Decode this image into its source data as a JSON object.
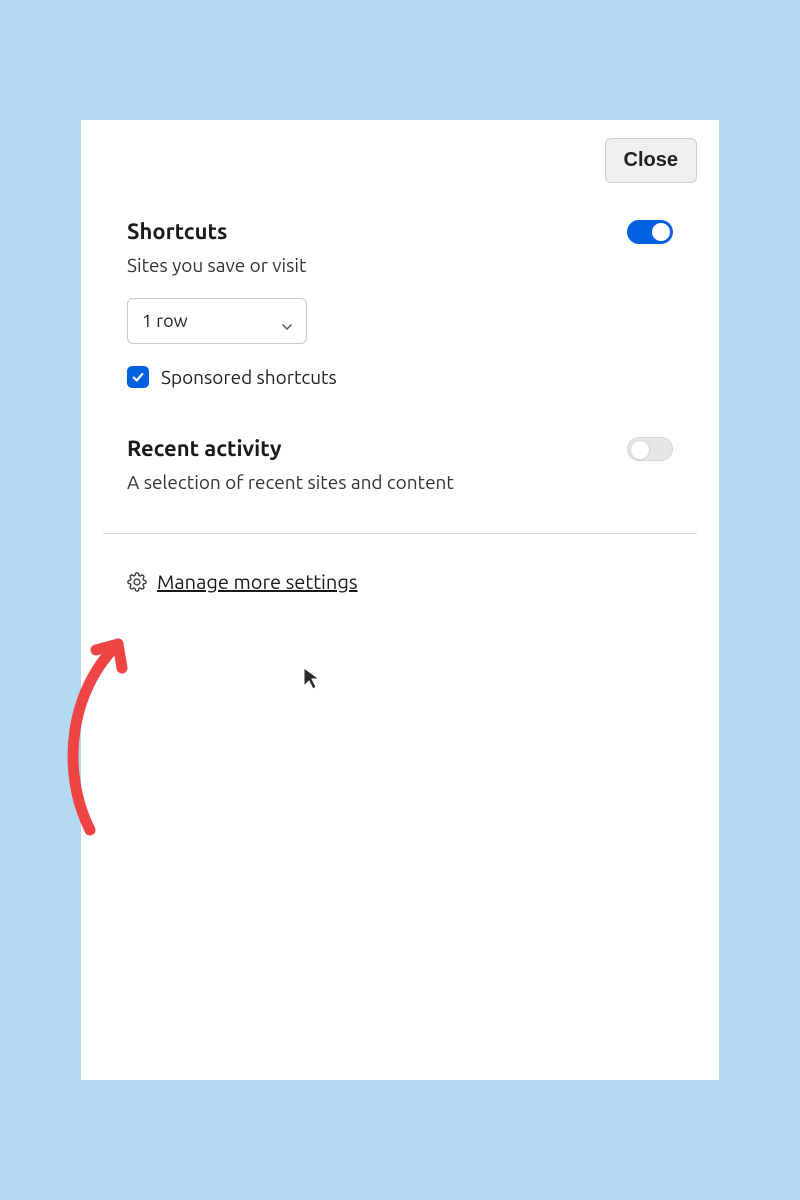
{
  "header": {
    "close_label": "Close"
  },
  "shortcuts": {
    "title": "Shortcuts",
    "subtitle": "Sites you save or visit",
    "toggle_on": true,
    "rows_select_value": "1 row",
    "sponsored_checked": true,
    "sponsored_label": "Sponsored shortcuts"
  },
  "recent": {
    "title": "Recent activity",
    "subtitle": "A selection of recent sites and content",
    "toggle_on": false
  },
  "footer": {
    "manage_label": "Manage more settings"
  },
  "colors": {
    "accent": "#0061e0",
    "annotation": "#ef4444"
  }
}
